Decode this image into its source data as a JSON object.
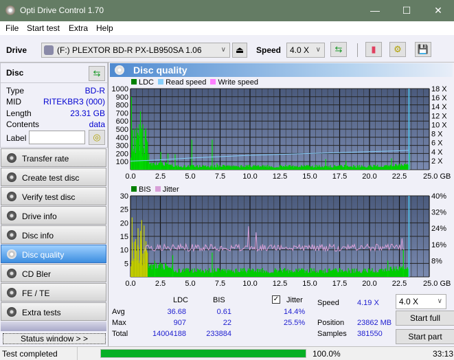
{
  "window": {
    "title": "Opti Drive Control 1.70",
    "minimize": "—",
    "maximize": "☐",
    "close": "✕"
  },
  "menu": {
    "file": "File",
    "start_test": "Start test",
    "extra": "Extra",
    "help": "Help"
  },
  "toolbar": {
    "drive_label": "Drive",
    "drive_value": "(F:)  PLEXTOR BD-R  PX-LB950SA 1.06",
    "speed_label": "Speed",
    "speed_value": "4.0 X",
    "icons": [
      "eject-icon",
      "refresh-icon",
      "erase-icon",
      "settings-icon",
      "save-icon"
    ]
  },
  "disc": {
    "header": "Disc",
    "rows": [
      {
        "k": "Type",
        "v": "BD-R"
      },
      {
        "k": "MID",
        "v": "RITEKBR3 (000)"
      },
      {
        "k": "Length",
        "v": "23.31 GB"
      },
      {
        "k": "Contents",
        "v": "data"
      }
    ],
    "label_key": "Label",
    "label_value": ""
  },
  "nav": [
    {
      "label": "Transfer rate",
      "active": false
    },
    {
      "label": "Create test disc",
      "active": false
    },
    {
      "label": "Verify test disc",
      "active": false
    },
    {
      "label": "Drive info",
      "active": false
    },
    {
      "label": "Disc info",
      "active": false
    },
    {
      "label": "Disc quality",
      "active": true
    },
    {
      "label": "CD Bler",
      "active": false
    },
    {
      "label": "FE / TE",
      "active": false
    },
    {
      "label": "Extra tests",
      "active": false
    }
  ],
  "status_window_btn": "Status window > >",
  "main": {
    "title": "Disc quality"
  },
  "chart_data": [
    {
      "type": "bar",
      "title": "LDC / Read speed",
      "legend": [
        "LDC",
        "Read speed",
        "Write speed"
      ],
      "legend_colors": [
        "#008000",
        "#87cefa",
        "#ff80ff"
      ],
      "xlabel": "GB",
      "xlim": [
        0,
        25
      ],
      "x_ticks": [
        "0.0",
        "2.5",
        "5.0",
        "7.5",
        "10.0",
        "12.5",
        "15.0",
        "17.5",
        "20.0",
        "22.5",
        "25.0 GB"
      ],
      "ylim": [
        0,
        1000
      ],
      "y_ticks": [
        "1000",
        "900",
        "800",
        "700",
        "600",
        "500",
        "400",
        "300",
        "200",
        "100"
      ],
      "y2lim": [
        0,
        18
      ],
      "y2_ticks": [
        "18 X",
        "16 X",
        "14 X",
        "12 X",
        "10 X",
        "8 X",
        "6 X",
        "4 X",
        "2 X"
      ],
      "ldc_peaks": [
        [
          0.05,
          900
        ],
        [
          0.3,
          400
        ],
        [
          0.5,
          520
        ],
        [
          0.7,
          560
        ],
        [
          0.8,
          720
        ],
        [
          0.9,
          500
        ],
        [
          1.0,
          560
        ],
        [
          1.2,
          480
        ],
        [
          1.5,
          200
        ],
        [
          2.5,
          220
        ],
        [
          3.1,
          200
        ],
        [
          3.7,
          190
        ],
        [
          5.1,
          370
        ],
        [
          6.8,
          370
        ],
        [
          7.2,
          80
        ],
        [
          16.3,
          130
        ],
        [
          18.0,
          110
        ],
        [
          21.8,
          140
        ],
        [
          23.3,
          200
        ]
      ],
      "ldc_baseline": 50,
      "read_speed": [
        [
          0,
          1.9
        ],
        [
          2.5,
          2.2
        ],
        [
          5,
          2.6
        ],
        [
          7.5,
          2.9
        ],
        [
          10,
          3.2
        ],
        [
          12.5,
          3.4
        ],
        [
          15,
          3.6
        ],
        [
          17.5,
          3.8
        ],
        [
          20,
          4.0
        ],
        [
          22.5,
          4.2
        ],
        [
          23.3,
          4.3
        ]
      ],
      "end_marker_gb": 23.3
    },
    {
      "type": "bar",
      "title": "BIS / Jitter",
      "legend": [
        "BIS",
        "Jitter"
      ],
      "legend_colors": [
        "#008000",
        "#d8a0d8"
      ],
      "xlim": [
        0,
        25
      ],
      "x_ticks": [
        "0.0",
        "2.5",
        "5.0",
        "7.5",
        "10.0",
        "12.5",
        "15.0",
        "17.5",
        "20.0",
        "22.5",
        "25.0 GB"
      ],
      "ylim": [
        0,
        30
      ],
      "y_ticks": [
        "30",
        "25",
        "20",
        "15",
        "10",
        "5"
      ],
      "y2lim": [
        0,
        40
      ],
      "y2_ticks": [
        "40%",
        "32%",
        "24%",
        "16%",
        "8%"
      ],
      "bis_peaks": [
        [
          0.1,
          22
        ],
        [
          0.4,
          14
        ],
        [
          0.6,
          18
        ],
        [
          0.8,
          17
        ],
        [
          0.9,
          21
        ],
        [
          1.1,
          19
        ],
        [
          1.3,
          10
        ],
        [
          2.0,
          6
        ],
        [
          3.5,
          8
        ],
        [
          6.8,
          9
        ],
        [
          21.5,
          6
        ],
        [
          22.8,
          10
        ]
      ],
      "bis_baseline": 3,
      "jitter_avg_pct": 14.4,
      "jitter_peaks": [
        [
          9.9,
          25
        ],
        [
          10.5,
          22
        ],
        [
          22.7,
          19
        ]
      ],
      "end_marker_gb": 23.3
    }
  ],
  "stats": {
    "col_ldc": "LDC",
    "col_bis": "BIS",
    "jitter_label": "Jitter",
    "jitter_checked": true,
    "rows": [
      {
        "label": "Avg",
        "ldc": "36.68",
        "bis": "0.61",
        "jitter": "14.4%"
      },
      {
        "label": "Max",
        "ldc": "907",
        "bis": "22",
        "jitter": "25.5%"
      },
      {
        "label": "Total",
        "ldc": "14004188",
        "bis": "233884",
        "jitter": ""
      }
    ],
    "speed_label": "Speed",
    "speed_value": "4.19 X",
    "position_label": "Position",
    "position_value": "23862 MB",
    "samples_label": "Samples",
    "samples_value": "381550",
    "speed_select": "4.0 X",
    "start_full": "Start full",
    "start_part": "Start part"
  },
  "statusbar": {
    "text": "Test completed",
    "progress_pct": 100,
    "progress_text": "100.0%",
    "time": "33:13"
  }
}
